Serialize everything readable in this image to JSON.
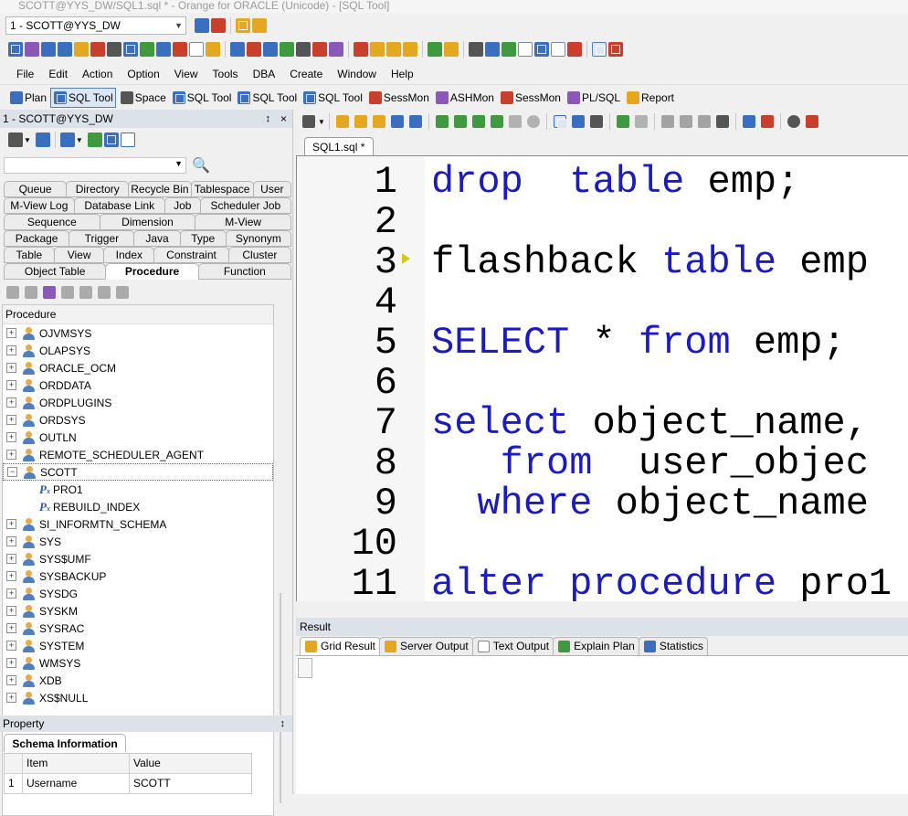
{
  "window": {
    "title": "SCOTT@YYS_DW/SQL1.sql * - Orange for ORACLE (Unicode) - [SQL Tool]"
  },
  "connection": {
    "selected": "1 - SCOTT@YYS_DW"
  },
  "menu": [
    "File",
    "Edit",
    "Action",
    "Option",
    "View",
    "Tools",
    "DBA",
    "Create",
    "Window",
    "Help"
  ],
  "tool_tabs": [
    "Plan",
    "SQL Tool",
    "Space",
    "SQL Tool",
    "SQL Tool",
    "SQL Tool",
    "SessMon",
    "ASHMon",
    "SessMon",
    "PL/SQL",
    "Report"
  ],
  "left_panel": {
    "title": "1 - SCOTT@YYS_DW",
    "pin": "↕",
    "close": "×",
    "object_tab_rows": [
      [
        "Queue",
        "Directory",
        "Recycle Bin",
        "Tablespace",
        "User"
      ],
      [
        "M-View Log",
        "Database Link",
        "Job",
        "Scheduler Job"
      ],
      [
        "Sequence",
        "Dimension",
        "M-View"
      ],
      [
        "Package",
        "Trigger",
        "Java",
        "Type",
        "Synonym"
      ],
      [
        "Table",
        "View",
        "Index",
        "Constraint",
        "Cluster"
      ],
      [
        "Object Table",
        "Procedure",
        "Function"
      ]
    ],
    "selected_tab": "Procedure",
    "tree_header": "Procedure",
    "tree": [
      {
        "label": "OJVMSYS",
        "type": "user",
        "exp": "+"
      },
      {
        "label": "OLAPSYS",
        "type": "user",
        "exp": "+"
      },
      {
        "label": "ORACLE_OCM",
        "type": "user",
        "exp": "+"
      },
      {
        "label": "ORDDATA",
        "type": "user",
        "exp": "+"
      },
      {
        "label": "ORDPLUGINS",
        "type": "user",
        "exp": "+"
      },
      {
        "label": "ORDSYS",
        "type": "user",
        "exp": "+"
      },
      {
        "label": "OUTLN",
        "type": "user",
        "exp": "+"
      },
      {
        "label": "REMOTE_SCHEDULER_AGENT",
        "type": "user",
        "exp": "+"
      },
      {
        "label": "SCOTT",
        "type": "user",
        "exp": "−",
        "selected": true
      },
      {
        "label": "PRO1",
        "type": "proc"
      },
      {
        "label": "REBUILD_INDEX",
        "type": "proc"
      },
      {
        "label": "SI_INFORMTN_SCHEMA",
        "type": "user",
        "exp": "+"
      },
      {
        "label": "SYS",
        "type": "user",
        "exp": "+"
      },
      {
        "label": "SYS$UMF",
        "type": "user",
        "exp": "+"
      },
      {
        "label": "SYSBACKUP",
        "type": "user",
        "exp": "+"
      },
      {
        "label": "SYSDG",
        "type": "user",
        "exp": "+"
      },
      {
        "label": "SYSKM",
        "type": "user",
        "exp": "+"
      },
      {
        "label": "SYSRAC",
        "type": "user",
        "exp": "+"
      },
      {
        "label": "SYSTEM",
        "type": "user",
        "exp": "+"
      },
      {
        "label": "WMSYS",
        "type": "user",
        "exp": "+"
      },
      {
        "label": "XDB",
        "type": "user",
        "exp": "+"
      },
      {
        "label": "XS$NULL",
        "type": "user",
        "exp": "+"
      }
    ]
  },
  "property": {
    "title": "Property",
    "tab": "Schema Information",
    "columns": [
      "Item",
      "Value"
    ],
    "rows": [
      {
        "num": "1",
        "item": "Username",
        "value": "SCOTT"
      }
    ]
  },
  "editor": {
    "tab": "SQL1.sql *",
    "lines": [
      {
        "n": "1",
        "code": [
          [
            "kw",
            "drop"
          ],
          [
            "",
            "  "
          ],
          [
            "kw",
            "table"
          ],
          [
            "",
            " emp;"
          ]
        ]
      },
      {
        "n": "2",
        "code": []
      },
      {
        "n": "3",
        "code": [
          [
            "",
            "flashback "
          ],
          [
            "kw",
            "table"
          ],
          [
            "",
            " emp"
          ]
        ]
      },
      {
        "n": "4",
        "code": []
      },
      {
        "n": "5",
        "code": [
          [
            "kw",
            "SELECT"
          ],
          [
            "",
            " * "
          ],
          [
            "kw",
            "from"
          ],
          [
            "",
            " emp;"
          ]
        ]
      },
      {
        "n": "6",
        "code": []
      },
      {
        "n": "7",
        "code": [
          [
            "kw",
            "select"
          ],
          [
            "",
            " object_name,"
          ]
        ]
      },
      {
        "n": "8",
        "code": [
          [
            "",
            "   "
          ],
          [
            "kw",
            "from"
          ],
          [
            "",
            "  user_objec"
          ]
        ]
      },
      {
        "n": "9",
        "code": [
          [
            "",
            "  "
          ],
          [
            "kw",
            "where"
          ],
          [
            "",
            " object_name"
          ]
        ]
      },
      {
        "n": "10",
        "code": []
      },
      {
        "n": "11",
        "code": [
          [
            "kw",
            "alter"
          ],
          [
            "",
            " "
          ],
          [
            "kw",
            "procedure"
          ],
          [
            "",
            " pro1"
          ]
        ]
      }
    ]
  },
  "result": {
    "title": "Result",
    "tabs": [
      "Grid Result",
      "Server Output",
      "Text Output",
      "Explain Plan",
      "Statistics"
    ]
  }
}
